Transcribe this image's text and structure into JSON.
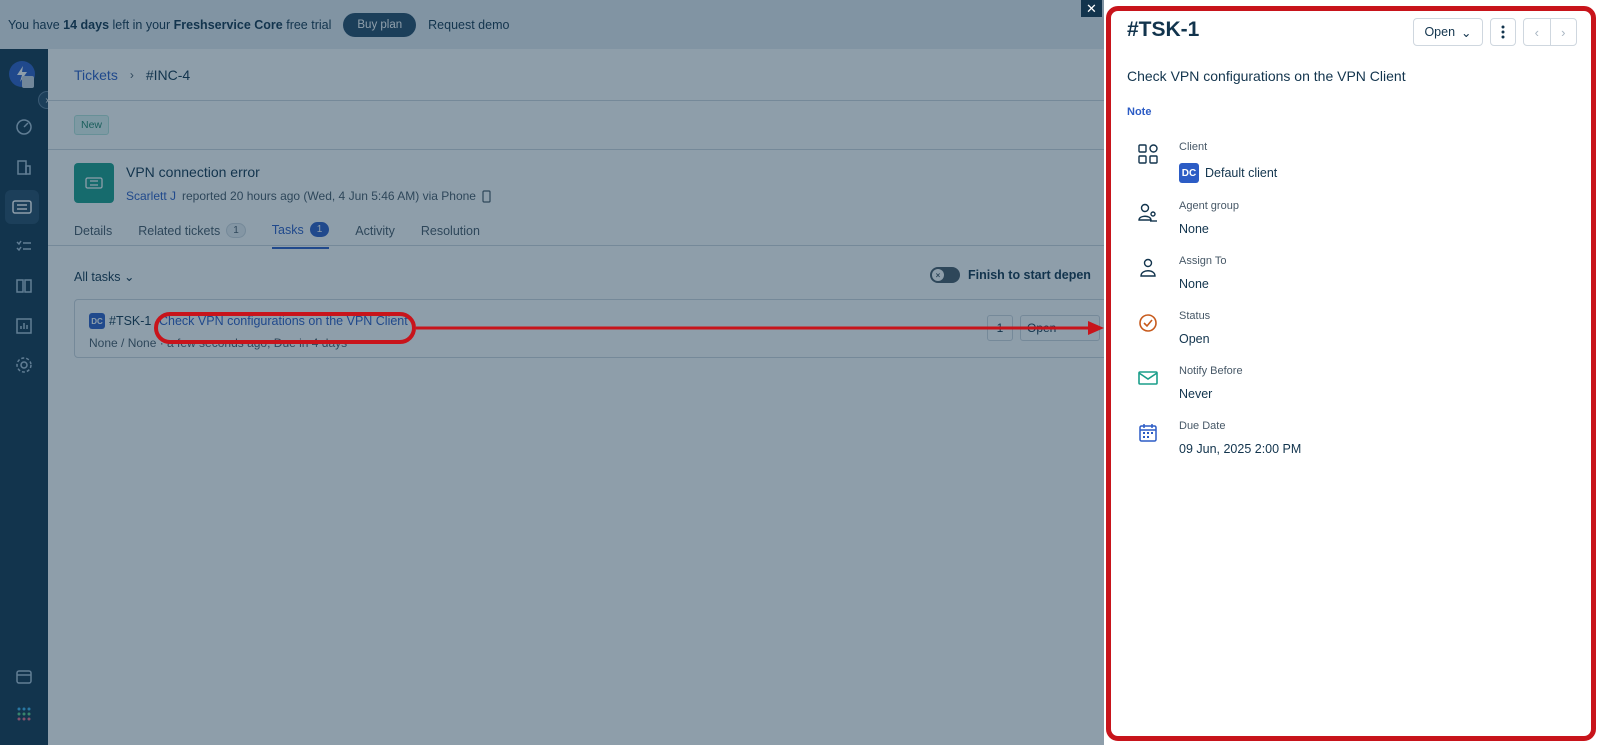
{
  "banner": {
    "prefix": "You have ",
    "days": "14 days",
    "middle": " left in your ",
    "product": "Freshservice Core",
    "suffix": " free trial",
    "buy_label": "Buy plan",
    "demo_label": "Request demo"
  },
  "breadcrumb": {
    "root": "Tickets",
    "current": "#INC-4"
  },
  "ticket": {
    "status_badge": "New",
    "title": "VPN connection error",
    "reporter": "Scarlett J",
    "meta": "reported 20 hours ago (Wed, 4 Jun 5:46 AM) via Phone"
  },
  "tabs": [
    {
      "label": "Details"
    },
    {
      "label": "Related tickets",
      "count": "1"
    },
    {
      "label": "Tasks",
      "count": "1"
    },
    {
      "label": "Activity"
    },
    {
      "label": "Resolution"
    }
  ],
  "tasks": {
    "filter_label": "All tasks",
    "toggle_label": "Finish to start depen",
    "item": {
      "badge": "DC",
      "id": "#TSK-1",
      "title": "Check VPN configurations on the VPN Client",
      "subtitle": "None / None   ·  a few seconds ago, Due in 4 days",
      "count": "1",
      "status": "Open"
    }
  },
  "panel": {
    "title": "#TSK-1",
    "status": "Open",
    "subject": "Check VPN configurations on the VPN Client",
    "note_label": "Note",
    "fields": {
      "client": {
        "label": "Client",
        "badge": "DC",
        "value": "Default client"
      },
      "agent_group": {
        "label": "Agent group",
        "value": "None"
      },
      "assign_to": {
        "label": "Assign To",
        "value": "None"
      },
      "status": {
        "label": "Status",
        "value": "Open"
      },
      "notify_before": {
        "label": "Notify Before",
        "value": "Never"
      },
      "due_date": {
        "label": "Due Date",
        "value": "09 Jun, 2025 2:00 PM"
      }
    }
  },
  "colors": {
    "accent": "#2c5cc5",
    "sidebar": "#12344d",
    "annotation": "#c8141b",
    "ticket_icon": "#1a9e8a"
  }
}
